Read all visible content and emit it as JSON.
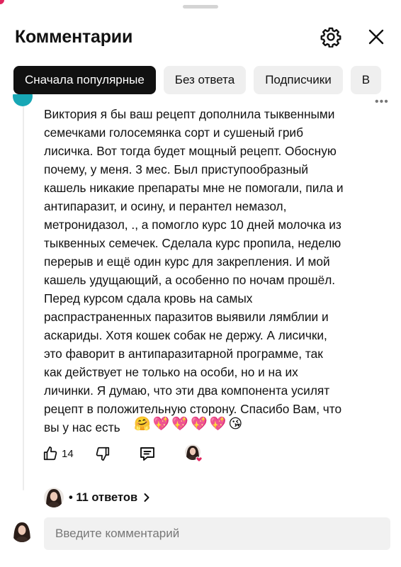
{
  "header": {
    "title": "Комментарии",
    "settings_icon": "gear-icon",
    "close_icon": "close-icon"
  },
  "filters": {
    "items": [
      {
        "label": "Сначала популярные",
        "active": true
      },
      {
        "label": "Без ответа",
        "active": false
      },
      {
        "label": "Подписчики",
        "active": false
      },
      {
        "label": "В",
        "active": false
      }
    ]
  },
  "comment": {
    "text": "Виктория я бы ваш рецепт дополнила тыквенными\nсемечками голосемянка сорт и  сушеный гриб\nлисичка. Вот тогда будет мощный рецепт. Обосную\nпочему,  у меня. 3 мес. Был приступообразный\nкашель никакие препараты мне не помогали, пила и\nантипаразит, и осину, и перантел немазол,\nметронидазол, ., а помогло курс 10 дней  молочка из\nтыквенных семечек. Сделала курс пропила, неделю\nперерыв и ещё один курс для закрепления. И мой\nкашель удущающий, а особенно по ночам прошёл.\nПеред курсом сдала кровь на самых\nраспраcтраненных паразитов выявили лямблии и\nаскариды. Хотя кошек собак не держу. А лисички,\nэто  фаворит в антипаразитарной программе, так\nкак действует не только на особи, но и на их\nличинки. Я думаю, что эти два компонента  усилят\nрецепт в положительную сторону. Спасибо Вам, что\nвы у нас есть",
    "emojis": [
      "🤗",
      "💖",
      "💖",
      "💖",
      "💖",
      "😘"
    ],
    "more": "•••",
    "likes": "14",
    "replies_label": "• 11 ответов",
    "accent_color": "#17a7b5"
  },
  "input": {
    "placeholder": "Введите комментарий",
    "value": ""
  },
  "colors": {
    "chip_active_bg": "#111111",
    "chip_bg": "#efefef",
    "heart": "#e0245e"
  }
}
